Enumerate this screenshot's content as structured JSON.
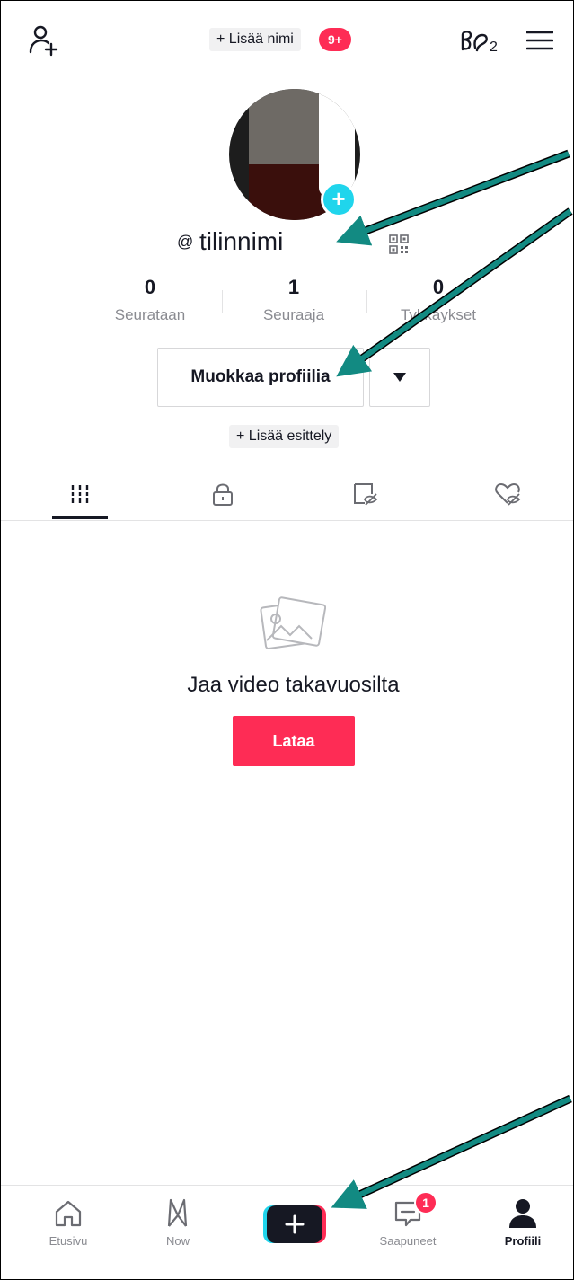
{
  "header": {
    "add_name_label": "+ Lisää nimi",
    "add_name_badge": "9+"
  },
  "profile": {
    "at": "@",
    "username": "tilinnimi"
  },
  "stats": [
    {
      "value": "0",
      "label": "Seurataan"
    },
    {
      "value": "1",
      "label": "Seuraaja"
    },
    {
      "value": "0",
      "label": "Tykkäykset"
    }
  ],
  "actions": {
    "edit_profile": "Muokkaa profiilia",
    "add_bio": "+ Lisää esittely"
  },
  "tabs": [
    {
      "icon": "grid-icon",
      "active": true
    },
    {
      "icon": "lock-icon",
      "active": false
    },
    {
      "icon": "hidden-videos-icon",
      "active": false
    },
    {
      "icon": "hidden-likes-icon",
      "active": false
    }
  ],
  "empty_state": {
    "title": "Jaa video takavuosilta",
    "button": "Lataa"
  },
  "bottom_nav": {
    "items": [
      {
        "label": "Etusivu",
        "icon": "home-icon"
      },
      {
        "label": "Now",
        "icon": "now-icon"
      },
      {
        "label": "",
        "icon": "create-icon"
      },
      {
        "label": "Saapuneet",
        "icon": "inbox-icon",
        "badge": "1"
      },
      {
        "label": "Profiili",
        "icon": "profile-icon",
        "active": true
      }
    ]
  },
  "colors": {
    "brand_red": "#fe2c55",
    "brand_cyan": "#20d5ec",
    "arrow": "#128a82"
  }
}
